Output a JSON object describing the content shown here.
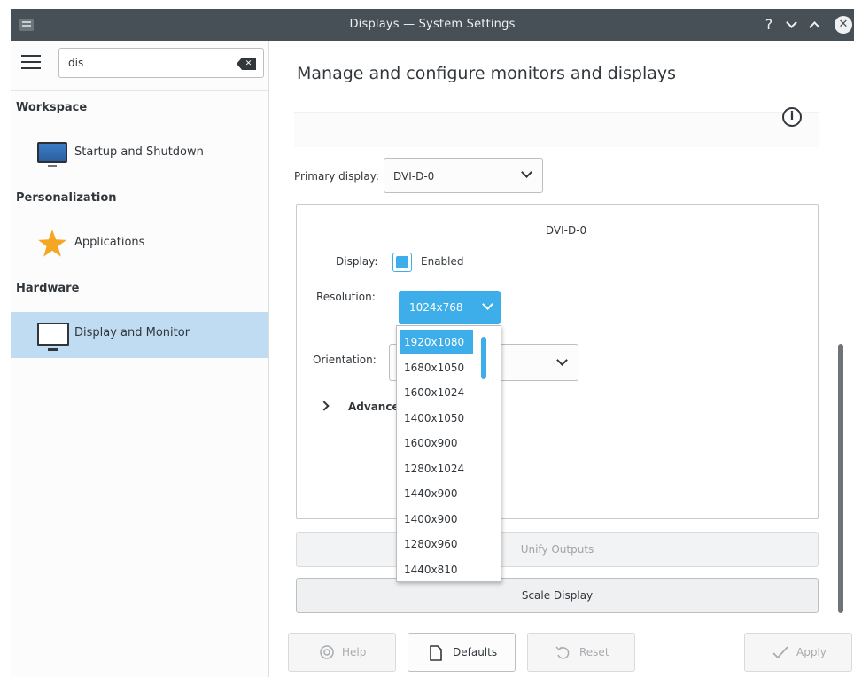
{
  "window": {
    "title": "Displays — System Settings",
    "help_glyph": "?",
    "minimize_glyph": "⌄",
    "maximize_glyph": "⌃",
    "close_glyph": "✕"
  },
  "sidebar": {
    "search_value": "dis",
    "clear_glyph": "✕",
    "categories": [
      {
        "label": "Workspace",
        "items": [
          {
            "label": "Startup and Shutdown",
            "icon": "monitor-icon"
          }
        ]
      },
      {
        "label": "Personalization",
        "items": [
          {
            "label": "Applications",
            "icon": "star-icon"
          }
        ]
      },
      {
        "label": "Hardware",
        "items": [
          {
            "label": "Display and Monitor",
            "icon": "display-icon",
            "selected": true
          }
        ]
      }
    ]
  },
  "main": {
    "heading": "Manage and configure monitors and displays",
    "info_glyph": "i",
    "primary_display_label": "Primary display:",
    "primary_display_value": "DVI-D-0",
    "panel": {
      "title": "DVI-D-0",
      "display_label": "Display:",
      "enabled_label": "Enabled",
      "enabled": true,
      "resolution_label": "Resolution:",
      "resolution_value": "1024x768",
      "orientation_label": "Orientation:",
      "advanced_label": "Advance"
    },
    "resolution_options": [
      "1920x1080",
      "1680x1050",
      "1600x1024",
      "1400x1050",
      "1600x900",
      "1280x1024",
      "1440x900",
      "1400x900",
      "1280x960",
      "1440x810"
    ],
    "highlighted_option": "1920x1080",
    "unify_outputs_label": "Unify Outputs",
    "scale_display_label": "Scale Display"
  },
  "footer": {
    "help_label": "Help",
    "defaults_label": "Defaults",
    "reset_label": "Reset",
    "apply_label": "Apply"
  },
  "colors": {
    "accent": "#3daee9",
    "selection": "#bfdcf3",
    "titlebar": "#475057"
  }
}
